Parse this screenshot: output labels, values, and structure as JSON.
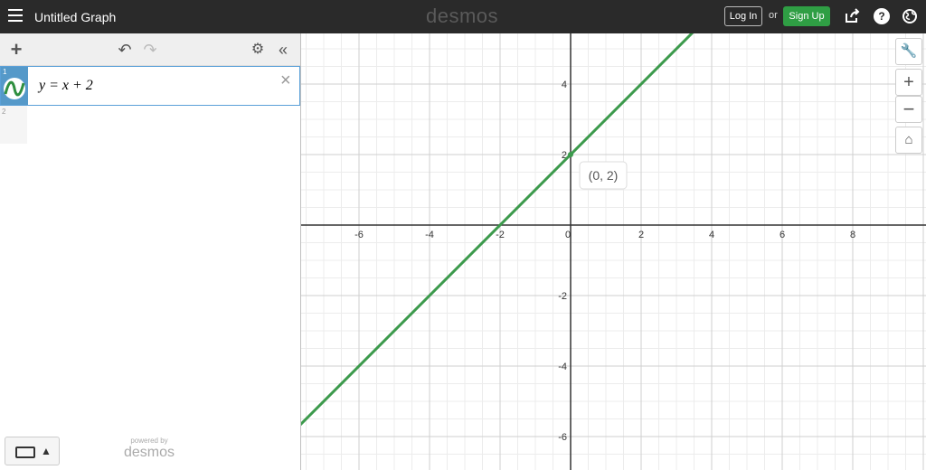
{
  "header": {
    "title": "Untitled Graph",
    "brand": "desmos",
    "login_label": "Log In",
    "or_label": "or",
    "signup_label": "Sign Up",
    "signup_color": "#2f9e44"
  },
  "toolbar": {
    "add_icon": "plus-icon",
    "undo_icon": "undo-icon",
    "redo_icon": "redo-icon",
    "settings_icon": "gear-icon",
    "collapse_icon": "double-chevron-left-icon"
  },
  "expressions": [
    {
      "index": "1",
      "latex_display": "y = x + 2",
      "color": "#2f8f3f"
    },
    {
      "index": "2",
      "latex_display": ""
    }
  ],
  "footer": {
    "powered_by": "powered by",
    "brand": "desmos"
  },
  "graph": {
    "x_ticks": [
      "-6",
      "-4",
      "-2",
      "0",
      "2",
      "4",
      "6",
      "8"
    ],
    "y_ticks": [
      "4",
      "2",
      "-2",
      "-4",
      "-6"
    ],
    "point_label": "(0, 2)",
    "line_color": "#3c9a4c"
  },
  "chart_data": {
    "type": "line",
    "title": "",
    "xlabel": "",
    "ylabel": "",
    "xlim": [
      -7.7,
      10
    ],
    "ylim": [
      -6.9,
      5.5
    ],
    "grid": true,
    "series": [
      {
        "name": "y = x + 2",
        "x": [
          -7.7,
          3.5
        ],
        "y": [
          -5.7,
          5.5
        ]
      }
    ],
    "annotations": [
      {
        "x": 0,
        "y": 2,
        "text": "(0, 2)"
      }
    ]
  }
}
